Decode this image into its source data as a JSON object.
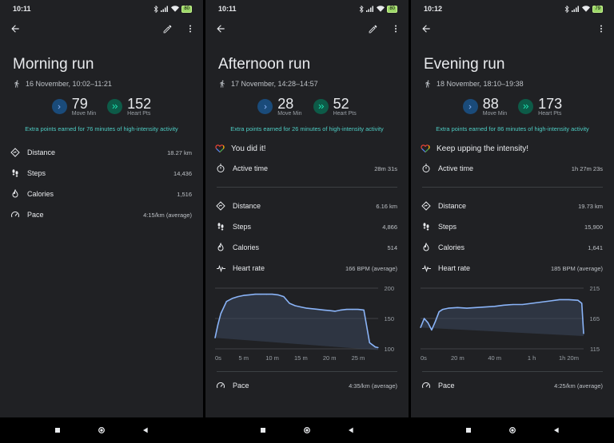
{
  "screens": [
    {
      "status_time": "10:11",
      "battery": "80",
      "show_edit": true,
      "title": "Morning run",
      "date": "16 November, 10:02–11:21",
      "move_min": "79",
      "move_label": "Move Min",
      "heart_pts": "152",
      "heart_label": "Heart Pts",
      "extra_text": "Extra points earned for 76 minutes of high-intensity activity",
      "stats": [
        {
          "label": "Distance",
          "value": "18.27 km",
          "icon": "distance-icon"
        },
        {
          "label": "Steps",
          "value": "14,436",
          "icon": "steps-icon"
        },
        {
          "label": "Calories",
          "value": "1,516",
          "icon": "calories-icon"
        },
        {
          "label": "Pace",
          "value": "4:15/km (average)",
          "icon": "pace-icon"
        }
      ]
    },
    {
      "status_time": "10:11",
      "battery": "80",
      "show_edit": true,
      "title": "Afternoon run",
      "date": "17 November, 14:28–14:57",
      "move_min": "28",
      "move_label": "Move Min",
      "heart_pts": "52",
      "heart_label": "Heart Pts",
      "extra_text": "Extra points earned for 26 minutes of high-intensity activity",
      "goal_text": "You did it!",
      "active_label": "Active time",
      "active_value": "28m 31s",
      "stats": [
        {
          "label": "Distance",
          "value": "6.16 km",
          "icon": "distance-icon"
        },
        {
          "label": "Steps",
          "value": "4,866",
          "icon": "steps-icon"
        },
        {
          "label": "Calories",
          "value": "514",
          "icon": "calories-icon"
        },
        {
          "label": "Heart rate",
          "value": "166 BPM (average)",
          "icon": "heart-rate-icon"
        }
      ],
      "chart_data": {
        "type": "line",
        "series": [
          {
            "x": [
              0,
              0.5,
              1,
              2,
              3,
              4,
              5,
              6,
              7,
              8,
              9,
              10,
              11,
              12,
              13,
              14,
              15,
              16,
              17,
              18,
              19,
              20,
              21,
              22,
              23,
              24,
              25,
              26,
              27,
              28,
              28.5
            ],
            "values": [
              118,
              140,
              158,
              178,
              183,
              186,
              188,
              189,
              190,
              190,
              190,
              190,
              189,
              186,
              175,
              171,
              169,
              167,
              166,
              165,
              164,
              163,
              162,
              164,
              165,
              165,
              165,
              164,
              110,
              103,
              102
            ]
          }
        ],
        "xlim": [
          0,
          28.5
        ],
        "ylim": [
          100,
          200
        ],
        "x_ticks": [
          {
            "v": 0,
            "label": "0s"
          },
          {
            "v": 5,
            "label": "5 m"
          },
          {
            "v": 10,
            "label": "10 m"
          },
          {
            "v": 15,
            "label": "15 m"
          },
          {
            "v": 20,
            "label": "20 m"
          },
          {
            "v": 25,
            "label": "25 m"
          }
        ],
        "y_ticks": [
          {
            "v": 200,
            "label": "200"
          },
          {
            "v": 150,
            "label": "150"
          },
          {
            "v": 100,
            "label": "100"
          }
        ],
        "line_color": "#8ab4f8",
        "grid": true
      },
      "pace": {
        "label": "Pace",
        "value": "4:35/km (average)",
        "icon": "pace-icon"
      }
    },
    {
      "status_time": "10:12",
      "battery": "79",
      "show_edit": false,
      "title": "Evening run",
      "date": "18 November, 18:10–19:38",
      "move_min": "88",
      "move_label": "Move Min",
      "heart_pts": "173",
      "heart_label": "Heart Pts",
      "extra_text": "Extra points earned for 86 minutes of high-intensity activity",
      "goal_text": "Keep upping the intensity!",
      "active_label": "Active time",
      "active_value": "1h 27m 23s",
      "stats": [
        {
          "label": "Distance",
          "value": "19.73 km",
          "icon": "distance-icon"
        },
        {
          "label": "Steps",
          "value": "15,900",
          "icon": "steps-icon"
        },
        {
          "label": "Calories",
          "value": "1,641",
          "icon": "calories-icon"
        },
        {
          "label": "Heart rate",
          "value": "185 BPM (average)",
          "icon": "heart-rate-icon"
        }
      ],
      "chart_data": {
        "type": "line",
        "series": [
          {
            "x": [
              0,
              2,
              4,
              6,
              8,
              10,
              12,
              15,
              20,
              25,
              30,
              35,
              40,
              45,
              50,
              55,
              60,
              65,
              70,
              75,
              80,
              85,
              87,
              88
            ],
            "values": [
              150,
              165,
              158,
              146,
              160,
              176,
              180,
              182,
              183,
              182,
              183,
              184,
              185,
              187,
              188,
              188,
              190,
              192,
              194,
              196,
              196,
              195,
              190,
              140
            ]
          }
        ],
        "xlim": [
          0,
          88
        ],
        "ylim": [
          115,
          215
        ],
        "x_ticks": [
          {
            "v": 0,
            "label": "0s"
          },
          {
            "v": 20,
            "label": "20 m"
          },
          {
            "v": 40,
            "label": "40 m"
          },
          {
            "v": 60,
            "label": "1 h"
          },
          {
            "v": 80,
            "label": "1h 20m"
          }
        ],
        "y_ticks": [
          {
            "v": 215,
            "label": "215"
          },
          {
            "v": 165,
            "label": "165"
          },
          {
            "v": 115,
            "label": "115"
          }
        ],
        "line_color": "#8ab4f8",
        "grid": true
      },
      "pace": {
        "label": "Pace",
        "value": "4:25/km (average)",
        "icon": "pace-icon"
      }
    }
  ],
  "colors": {
    "background": "#202124",
    "accent_move": "#4285f4",
    "accent_heart": "#1de9b6",
    "extra_text": "#4ecdc4"
  }
}
